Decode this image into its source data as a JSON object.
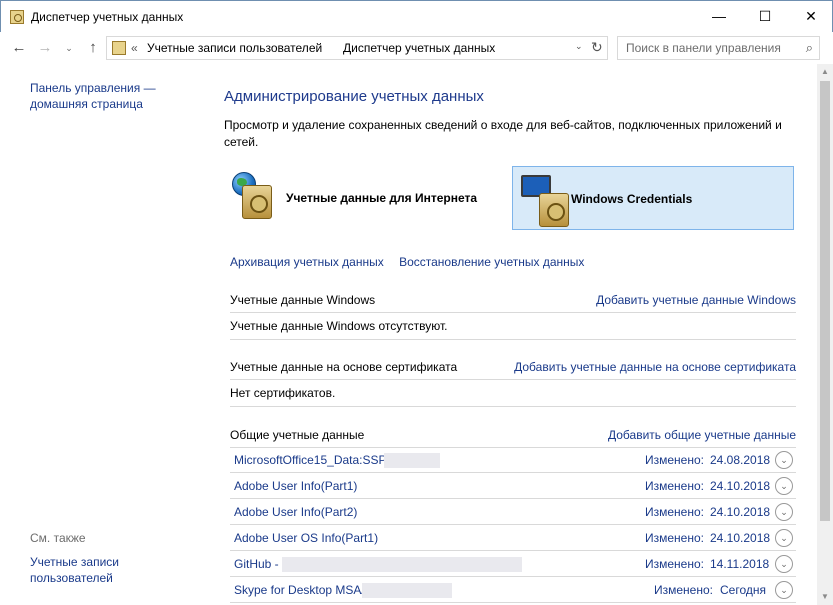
{
  "window": {
    "title": "Диспетчер учетных данных",
    "minimize_glyph": "—",
    "maximize_glyph": "☐",
    "close_glyph": "✕"
  },
  "navbar": {
    "back_glyph": "←",
    "forward_glyph": "→",
    "recent_glyph": "⌄",
    "up_glyph": "↑",
    "breadcrumb_prefix": "«",
    "breadcrumb": [
      "Учетные записи пользователей",
      "Диспетчер учетных данных"
    ],
    "breadcrumb_sep": "›",
    "dropdown_glyph": "⌄",
    "refresh_glyph": "↻",
    "search_placeholder": "Поиск в панели управления",
    "search_glyph": "⌕"
  },
  "sidebar": {
    "home_link": "Панель управления — домашняя страница",
    "see_also_label": "См. также",
    "user_accounts_link": "Учетные записи пользователей"
  },
  "main": {
    "help_glyph": "?",
    "heading": "Администрирование учетных данных",
    "description": "Просмотр и удаление сохраненных сведений о входе для веб-сайтов, подключенных приложений и сетей.",
    "tiles": [
      {
        "label": "Учетные данные для Интернета",
        "icon": "globe-vault-icon",
        "selected": false
      },
      {
        "label": "Windows Credentials",
        "icon": "monitor-vault-icon",
        "selected": true
      }
    ],
    "backup_link": "Архивация учетных данных",
    "restore_link": "Восстановление учетных данных",
    "sections": {
      "windows": {
        "title": "Учетные данные Windows",
        "add_link": "Добавить учетные данные Windows",
        "empty_text": "Учетные данные Windows отсутствуют."
      },
      "certificate": {
        "title": "Учетные данные на основе сертификата",
        "add_link": "Добавить учетные данные на основе сертификата",
        "empty_text": "Нет сертификатов."
      },
      "generic": {
        "title": "Общие учетные данные",
        "add_link": "Добавить общие учетные данные",
        "modified_label": "Изменено:",
        "expand_glyph": "⌄",
        "items": [
          {
            "name": "MicrosoftOffice15_Data:SSPI",
            "modified": "24.08.2018"
          },
          {
            "name": "Adobe User Info(Part1)",
            "modified": "24.10.2018"
          },
          {
            "name": "Adobe User Info(Part2)",
            "modified": "24.10.2018"
          },
          {
            "name": "Adobe User OS Info(Part1)",
            "modified": "24.10.2018"
          },
          {
            "name": "GitHub -",
            "modified": "14.11.2018"
          },
          {
            "name": "Skype for Desktop MSA/",
            "modified": "Сегодня"
          }
        ]
      }
    }
  },
  "scrollbar": {
    "up_glyph": "▲",
    "down_glyph": "▼"
  }
}
